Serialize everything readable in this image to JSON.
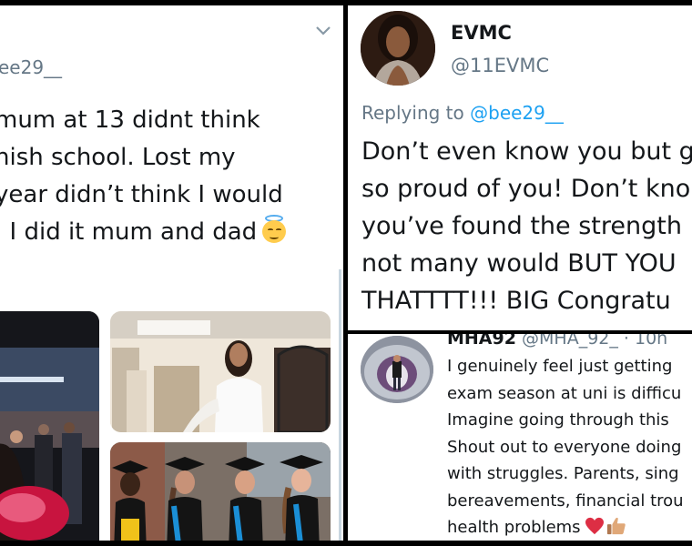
{
  "left_tweet": {
    "handle": "ee29__",
    "lines": [
      "mum at 13 didnt think",
      "nish school. Lost my",
      "year didn’t think I would",
      ". I did it mum and dad"
    ],
    "emoji": "smiling-face-with-halo-icon"
  },
  "reply_tweet": {
    "name": "EVMC",
    "handle": "@11EVMC",
    "replying_prefix": "Replying to",
    "replying_to": "@bee29__",
    "lines": [
      "Don’t even know you but g",
      "so proud of you! Don’t kno",
      "you’ve found the strength",
      "not many would BUT YOU",
      "THATTTT!!! BIG Congratu"
    ]
  },
  "comment_tweet": {
    "name": "MHA92",
    "handle": "@MHA_92_",
    "time": "· 10h",
    "lines": [
      "I genuinely feel just getting",
      "exam season at uni is difficu",
      "Imagine going through this",
      "Shout out to everyone doing",
      "with struggles. Parents, sing",
      "bereavements, financial trou",
      "health problems"
    ],
    "emojis": [
      "red-heart-icon",
      "thumbs-up-icon"
    ]
  },
  "colors": {
    "link": "#1da1f2",
    "muted": "#657786",
    "text": "#14171a",
    "divider": "#000000"
  }
}
